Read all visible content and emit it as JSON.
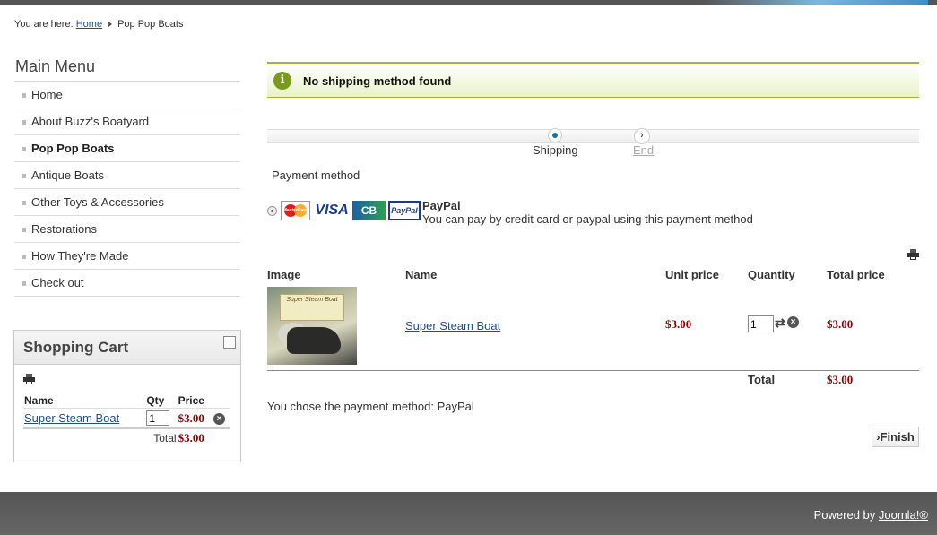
{
  "breadcrumb": {
    "prefix": "You are here:",
    "home": "Home",
    "current": "Pop Pop Boats"
  },
  "main_menu": {
    "title": "Main Menu",
    "items": [
      {
        "label": "Home"
      },
      {
        "label": "About Buzz's Boatyard"
      },
      {
        "label": "Pop Pop Boats",
        "active": true
      },
      {
        "label": "Antique Boats"
      },
      {
        "label": "Other Toys & Accessories"
      },
      {
        "label": "Restorations"
      },
      {
        "label": "How They're Made"
      },
      {
        "label": "Check out"
      }
    ]
  },
  "cart": {
    "title": "Shopping Cart",
    "minimize": "−",
    "headers": {
      "name": "Name",
      "qty": "Qty",
      "price": "Price"
    },
    "item": {
      "name": "Super Steam Boat",
      "qty": "1",
      "price": "$3.00"
    },
    "total_label": "Total",
    "total_value": "$3.00"
  },
  "notice": {
    "icon": "i",
    "message": "No shipping method found"
  },
  "steps": {
    "step1": "Shipping",
    "step2": "End"
  },
  "payment": {
    "title": "Payment method",
    "option_name": "PayPal",
    "option_desc": "You can pay by credit card or paypal using this payment method",
    "cards": {
      "mastercard": "MasterCard",
      "visa": "VISA",
      "cb": "CB",
      "paypal": "PayPal"
    }
  },
  "order": {
    "headers": {
      "image": "Image",
      "name": "Name",
      "unit_price": "Unit price",
      "quantity": "Quantity",
      "total_price": "Total price"
    },
    "item": {
      "image_label": "Super Steam Boat",
      "name": "Super Steam Boat",
      "unit_price": "$3.00",
      "quantity": "1",
      "total_price": "$3.00"
    },
    "total_label": "Total",
    "total_value": "$3.00"
  },
  "chose_text": "You chose the payment method: PayPal",
  "finish_label": "›Finish",
  "footer": {
    "prefix": "Powered by",
    "link": "Joomla!®"
  },
  "colors": {
    "price": "#8b0000",
    "link": "#1f4f8a",
    "notice_border": "#9cb73f"
  }
}
